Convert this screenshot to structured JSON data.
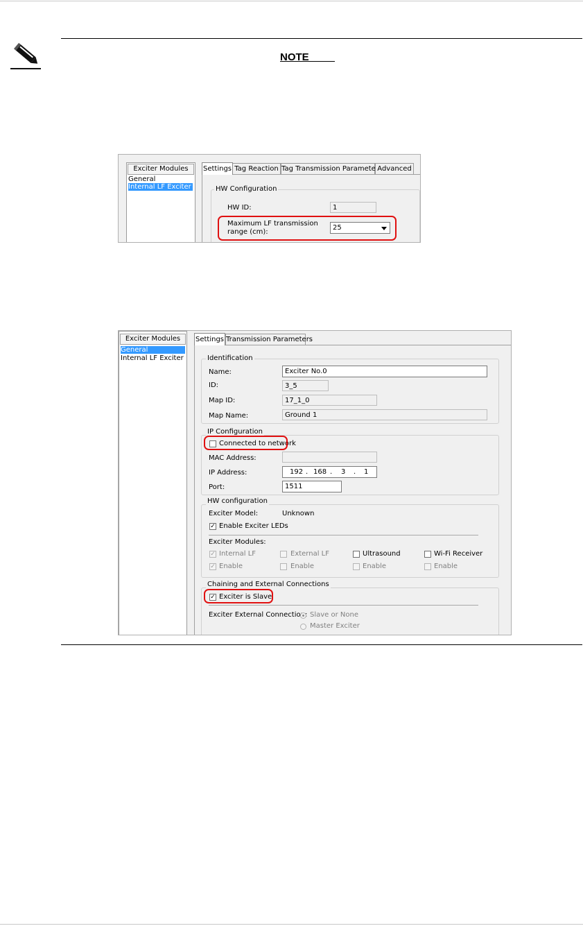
{
  "note": {
    "icon": "pencil-note-icon",
    "heading": "NOTE"
  },
  "shot1": {
    "modules_header": "Exciter Modules",
    "modules": [
      "General",
      "Internal LF Exciter"
    ],
    "tabs": [
      "Settings",
      "Tag Reaction",
      "Tag Transmission Parameters",
      "Advanced"
    ],
    "group_title": "HW Configuration",
    "hw_id_label": "HW ID:",
    "hw_id_value": "1",
    "range_label_1": "Maximum LF transmission",
    "range_label_2": "range (cm):",
    "range_value": "25"
  },
  "shot2": {
    "modules_header": "Exciter Modules",
    "modules": [
      "General",
      "Internal LF Exciter"
    ],
    "tabs": [
      "Settings",
      "Transmission Parameters"
    ],
    "ident": {
      "title": "Identification",
      "name_label": "Name:",
      "name_value": "Exciter No.0",
      "id_label": "ID:",
      "id_value": "3_5",
      "map_id_label": "Map ID:",
      "map_id_value": "17_1_0",
      "map_name_label": "Map Name:",
      "map_name_value": "Ground 1"
    },
    "ip": {
      "title": "IP Configuration",
      "connected_label": "Connected to network",
      "mac_label": "MAC Address:",
      "ip_label": "IP Address:",
      "ip_octets": [
        "192",
        "168",
        "3",
        "1"
      ],
      "port_label": "Port:",
      "port_value": "1511"
    },
    "hw": {
      "title": "HW configuration",
      "model_label": "Exciter Model:",
      "model_value": "Unknown",
      "leds_label": "Enable Exciter LEDs",
      "modules_label": "Exciter Modules:",
      "module_names": [
        "Internal LF",
        "External LF",
        "Ultrasound",
        "Wi-Fi Receiver"
      ],
      "enable_label": "Enable"
    },
    "chain": {
      "title": "Chaining and External Connections",
      "slave_label": "Exciter is Slave",
      "ext_label": "Exciter External Connection:",
      "options": [
        "Slave or None",
        "Master Exciter"
      ]
    }
  }
}
